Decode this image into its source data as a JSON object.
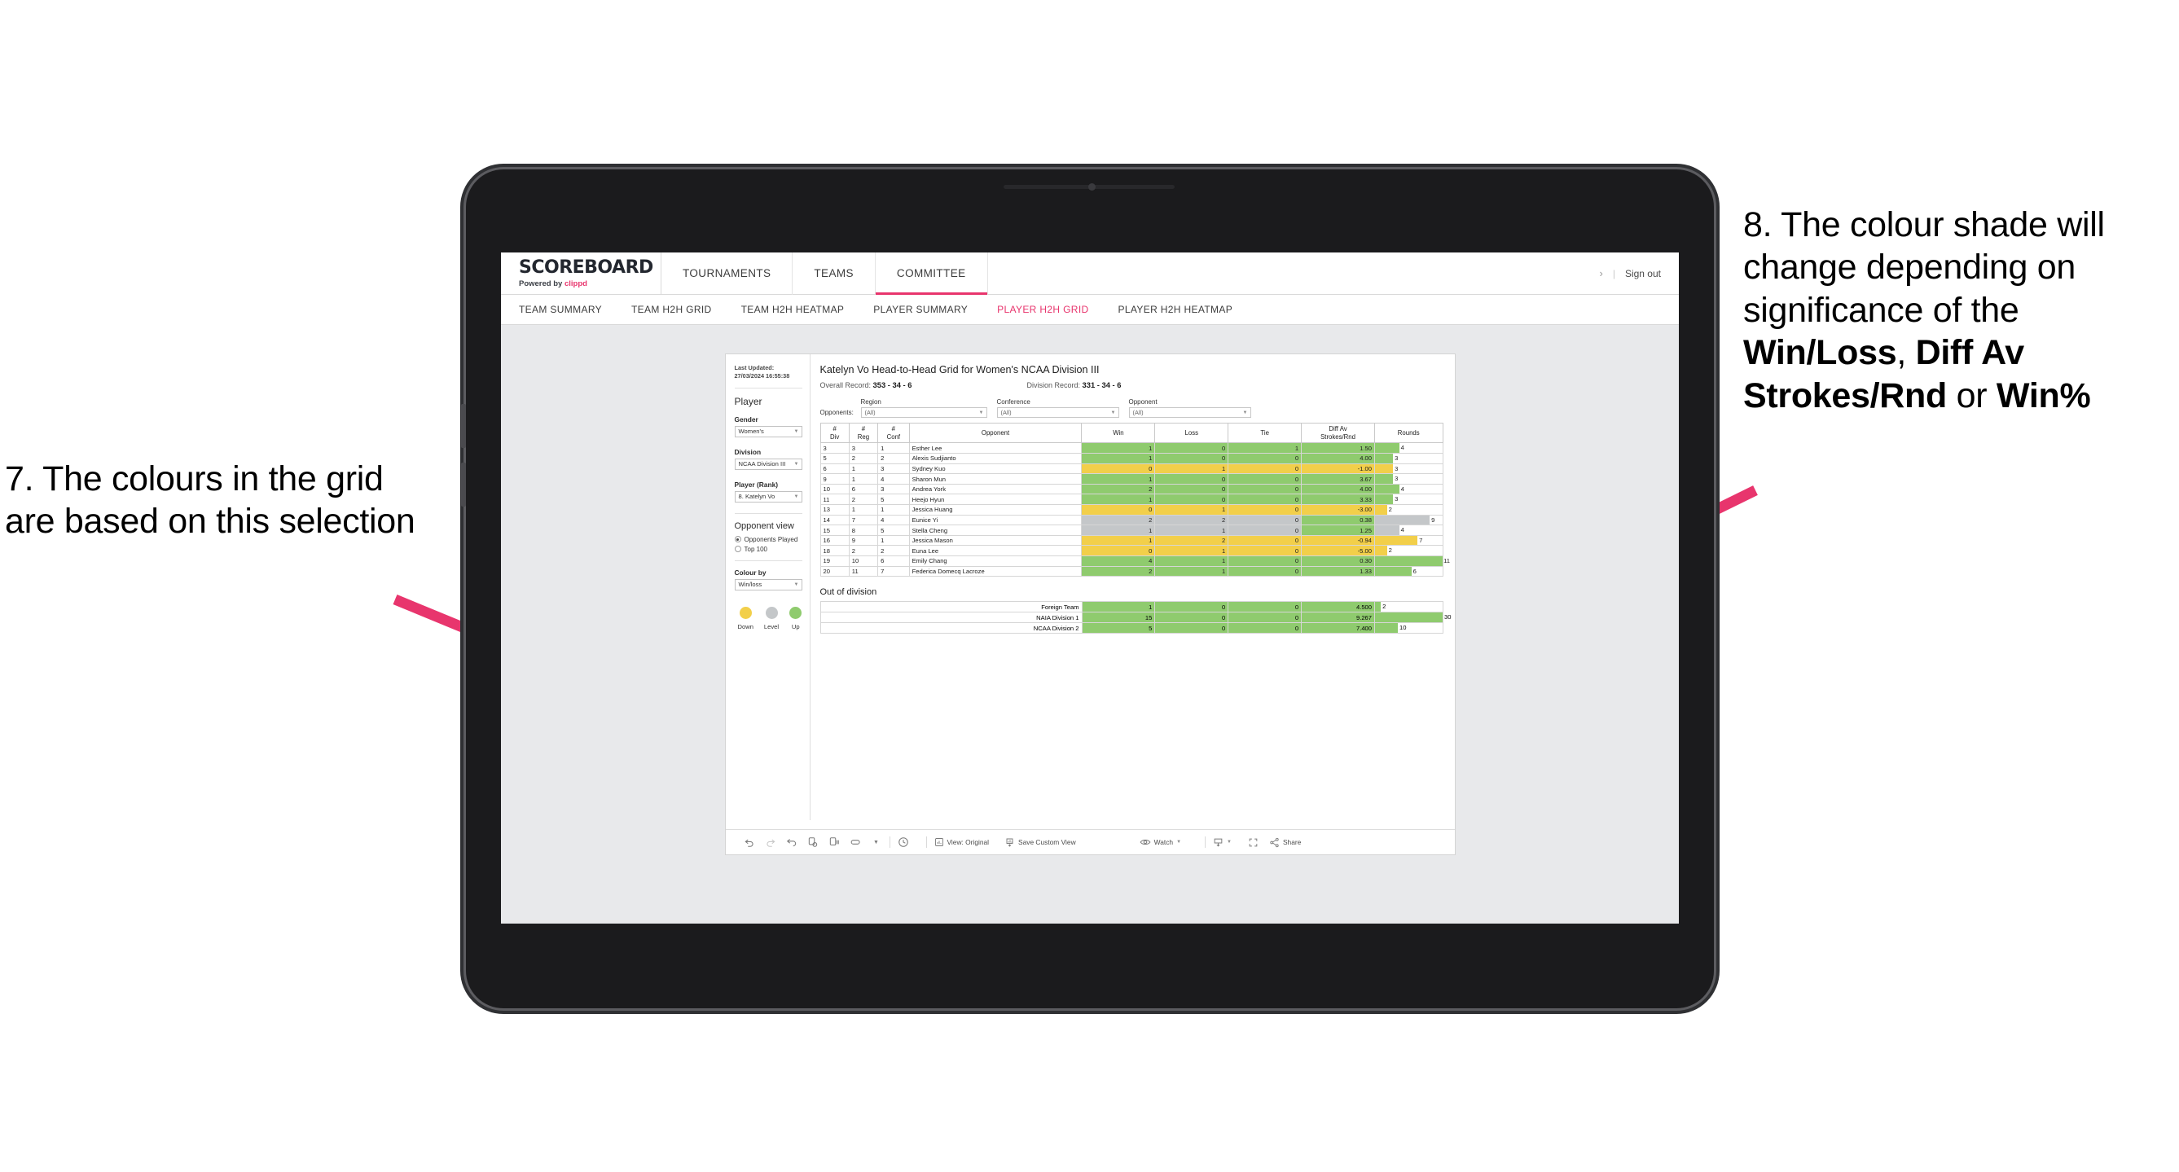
{
  "annotations": {
    "left": {
      "name": "annotation-7",
      "text": "7. The colours in the grid are based on this selection"
    },
    "right": {
      "name": "annotation-8",
      "prefix": "8. The colour shade will change depending on significance of the ",
      "bold1": "Win/Loss",
      "mid1": ", ",
      "bold2": "Diff Av Strokes/Rnd",
      "mid2": " or ",
      "bold3": "Win%"
    },
    "arrow_color": "#e8356d"
  },
  "topnav": {
    "logo": "SCOREBOARD",
    "logo_sub_prefix": "Powered by ",
    "logo_sub_brand": "clippd",
    "tabs": [
      {
        "label": "TOURNAMENTS",
        "active": false
      },
      {
        "label": "TEAMS",
        "active": false
      },
      {
        "label": "COMMITTEE",
        "active": true
      }
    ],
    "chevron": "›",
    "divider": "|",
    "signout": "Sign out"
  },
  "subnav": {
    "items": [
      {
        "label": "TEAM SUMMARY",
        "active": false
      },
      {
        "label": "TEAM H2H GRID",
        "active": false
      },
      {
        "label": "TEAM H2H HEATMAP",
        "active": false
      },
      {
        "label": "PLAYER SUMMARY",
        "active": false
      },
      {
        "label": "PLAYER H2H GRID",
        "active": true
      },
      {
        "label": "PLAYER H2H HEATMAP",
        "active": false
      }
    ]
  },
  "sidebar": {
    "last_updated": "Last Updated: 27/03/2024 16:55:38",
    "title": "Player",
    "gender": {
      "label": "Gender",
      "value": "Women's"
    },
    "division": {
      "label": "Division",
      "value": "NCAA Division III"
    },
    "player_rank": {
      "label": "Player (Rank)",
      "value": "8. Katelyn Vo"
    },
    "opponent_view": {
      "label": "Opponent view",
      "options": [
        {
          "label": "Opponents Played",
          "selected": true
        },
        {
          "label": "Top 100",
          "selected": false
        }
      ]
    },
    "colour_by": {
      "label": "Colour by",
      "value": "Win/loss"
    },
    "legend": [
      {
        "label": "Down",
        "color": "#f2cf4a"
      },
      {
        "label": "Level",
        "color": "#c4c7c9"
      },
      {
        "label": "Up",
        "color": "#8fcb6e"
      }
    ]
  },
  "viz": {
    "title": "Katelyn Vo Head-to-Head Grid for Women's NCAA Division III",
    "overall_record_label": "Overall Record: ",
    "overall_record_value": "353 -  34 - 6",
    "division_record_label": "Division Record: ",
    "division_record_value": "331 -  34 - 6",
    "opponents_label": "Opponents:",
    "filters": [
      {
        "caption": "Region",
        "value": "(All)"
      },
      {
        "caption": "Conference",
        "value": "(All)"
      },
      {
        "caption": "Opponent",
        "value": "(All)"
      }
    ],
    "columns": [
      "# Div",
      "# Reg",
      "# Conf",
      "Opponent",
      "Win",
      "Loss",
      "Tie",
      "Diff Av Strokes/Rnd",
      "Rounds"
    ],
    "col_div": "#\nDiv",
    "col_reg": "#\nReg",
    "col_conf": "#\nConf",
    "col_opponent": "Opponent",
    "col_win": "Win",
    "col_loss": "Loss",
    "col_tie": "Tie",
    "col_diff": "Diff Av Strokes/Rnd",
    "col_rounds": "Rounds",
    "out_of_division_title": "Out of division"
  },
  "chart_data": {
    "type": "table",
    "title": "Katelyn Vo Head-to-Head Grid for Women's NCAA Division III",
    "columns": [
      "#Div",
      "#Reg",
      "#Conf",
      "Opponent",
      "Win",
      "Loss",
      "Tie",
      "Diff Av Strokes/Rnd",
      "Rounds"
    ],
    "colour_scale": {
      "up": "#8fcb6e",
      "level": "#c4c7c9",
      "down": "#f2cf4a"
    },
    "rounds_max": 11,
    "rows": [
      {
        "div": "3",
        "reg": "3",
        "conf": "1",
        "opponent": "Esther Lee",
        "win": "1",
        "loss": "0",
        "tie": "1",
        "diff": "1.50",
        "rounds": "4",
        "color": "up"
      },
      {
        "div": "5",
        "reg": "2",
        "conf": "2",
        "opponent": "Alexis Sudjianto",
        "win": "1",
        "loss": "0",
        "tie": "0",
        "diff": "4.00",
        "rounds": "3",
        "color": "up"
      },
      {
        "div": "6",
        "reg": "1",
        "conf": "3",
        "opponent": "Sydney Kuo",
        "win": "0",
        "loss": "1",
        "tie": "0",
        "diff": "-1.00",
        "rounds": "3",
        "color": "down"
      },
      {
        "div": "9",
        "reg": "1",
        "conf": "4",
        "opponent": "Sharon Mun",
        "win": "1",
        "loss": "0",
        "tie": "0",
        "diff": "3.67",
        "rounds": "3",
        "color": "up"
      },
      {
        "div": "10",
        "reg": "6",
        "conf": "3",
        "opponent": "Andrea York",
        "win": "2",
        "loss": "0",
        "tie": "0",
        "diff": "4.00",
        "rounds": "4",
        "color": "up"
      },
      {
        "div": "11",
        "reg": "2",
        "conf": "5",
        "opponent": "Heejo Hyun",
        "win": "1",
        "loss": "0",
        "tie": "0",
        "diff": "3.33",
        "rounds": "3",
        "color": "up"
      },
      {
        "div": "13",
        "reg": "1",
        "conf": "1",
        "opponent": "Jessica Huang",
        "win": "0",
        "loss": "1",
        "tie": "0",
        "diff": "-3.00",
        "rounds": "2",
        "color": "down"
      },
      {
        "div": "14",
        "reg": "7",
        "conf": "4",
        "opponent": "Eunice Yi",
        "win": "2",
        "loss": "2",
        "tie": "0",
        "diff": "0.38",
        "rounds": "9",
        "color": "level",
        "diff_color": "up"
      },
      {
        "div": "15",
        "reg": "8",
        "conf": "5",
        "opponent": "Stella Cheng",
        "win": "1",
        "loss": "1",
        "tie": "0",
        "diff": "1.25",
        "rounds": "4",
        "color": "level",
        "diff_color": "up"
      },
      {
        "div": "16",
        "reg": "9",
        "conf": "1",
        "opponent": "Jessica Mason",
        "win": "1",
        "loss": "2",
        "tie": "0",
        "diff": "-0.94",
        "rounds": "7",
        "color": "down"
      },
      {
        "div": "18",
        "reg": "2",
        "conf": "2",
        "opponent": "Euna Lee",
        "win": "0",
        "loss": "1",
        "tie": "0",
        "diff": "-5.00",
        "rounds": "2",
        "color": "down"
      },
      {
        "div": "19",
        "reg": "10",
        "conf": "6",
        "opponent": "Emily Chang",
        "win": "4",
        "loss": "1",
        "tie": "0",
        "diff": "0.30",
        "rounds": "11",
        "color": "up"
      },
      {
        "div": "20",
        "reg": "11",
        "conf": "7",
        "opponent": "Federica Domecq Lacroze",
        "win": "2",
        "loss": "1",
        "tie": "0",
        "diff": "1.33",
        "rounds": "6",
        "color": "up"
      }
    ],
    "out_of_division": {
      "rounds_max": 30,
      "rows": [
        {
          "name": "Foreign Team",
          "win": "1",
          "loss": "0",
          "tie": "0",
          "diff": "4.500",
          "rounds": "2",
          "color": "up"
        },
        {
          "name": "NAIA Division 1",
          "win": "15",
          "loss": "0",
          "tie": "0",
          "diff": "9.267",
          "rounds": "30",
          "color": "up"
        },
        {
          "name": "NCAA Division 2",
          "win": "5",
          "loss": "0",
          "tie": "0",
          "diff": "7.400",
          "rounds": "10",
          "color": "up"
        }
      ]
    }
  },
  "toolbar": {
    "view_label": "View: Original",
    "save_label": "Save Custom View",
    "watch_label": "Watch",
    "share_label": "Share"
  }
}
